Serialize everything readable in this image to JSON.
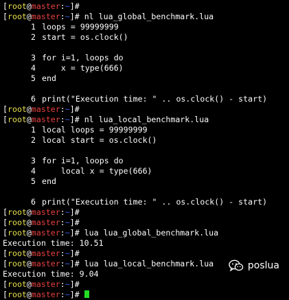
{
  "prompt": {
    "open_bracket": "[",
    "user": "root",
    "at": "@",
    "host": "master",
    "colon": ":",
    "path": "~",
    "close": "]#"
  },
  "lines": [
    {
      "kind": "prompt",
      "command": ""
    },
    {
      "kind": "prompt",
      "command": " nl lua_global_benchmark.lua"
    },
    {
      "kind": "code",
      "num": "1",
      "text": "loops = 99999999"
    },
    {
      "kind": "code",
      "num": "2",
      "text": "start = os.clock()"
    },
    {
      "kind": "blank"
    },
    {
      "kind": "code",
      "num": "3",
      "text": "for i=1, loops do"
    },
    {
      "kind": "code",
      "num": "4",
      "text": "    x = type(666)"
    },
    {
      "kind": "code",
      "num": "5",
      "text": "end"
    },
    {
      "kind": "blank"
    },
    {
      "kind": "code",
      "num": "6",
      "text": "print(\"Execution time: \" .. os.clock() - start)"
    },
    {
      "kind": "prompt",
      "command": ""
    },
    {
      "kind": "prompt",
      "command": " nl lua_local_benchmark.lua"
    },
    {
      "kind": "code",
      "num": "1",
      "text": "local loops = 99999999"
    },
    {
      "kind": "code",
      "num": "2",
      "text": "local start = os.clock()"
    },
    {
      "kind": "blank"
    },
    {
      "kind": "code",
      "num": "3",
      "text": "for i=1, loops do"
    },
    {
      "kind": "code",
      "num": "4",
      "text": "    local x = type(666)"
    },
    {
      "kind": "code",
      "num": "5",
      "text": "end"
    },
    {
      "kind": "blank"
    },
    {
      "kind": "code",
      "num": "6",
      "text": "print(\"Execution time: \" .. os.clock() - start)"
    },
    {
      "kind": "prompt",
      "command": ""
    },
    {
      "kind": "prompt",
      "command": ""
    },
    {
      "kind": "prompt",
      "command": " lua lua_global_benchmark.lua"
    },
    {
      "kind": "output",
      "text": "Execution time: 10.51"
    },
    {
      "kind": "prompt",
      "command": ""
    },
    {
      "kind": "prompt",
      "command": " lua lua_local_benchmark.lua"
    },
    {
      "kind": "output",
      "text": "Execution time: 9.04"
    },
    {
      "kind": "prompt",
      "command": ""
    },
    {
      "kind": "prompt",
      "command": " ",
      "cursor": true
    }
  ],
  "watermark": {
    "icon": "wechat-icon",
    "text": "poslua"
  },
  "colors": {
    "background": "#000000",
    "user": "#e8e050",
    "host": "#e84040",
    "path": "#3060e8",
    "cursor": "#22dd22"
  }
}
